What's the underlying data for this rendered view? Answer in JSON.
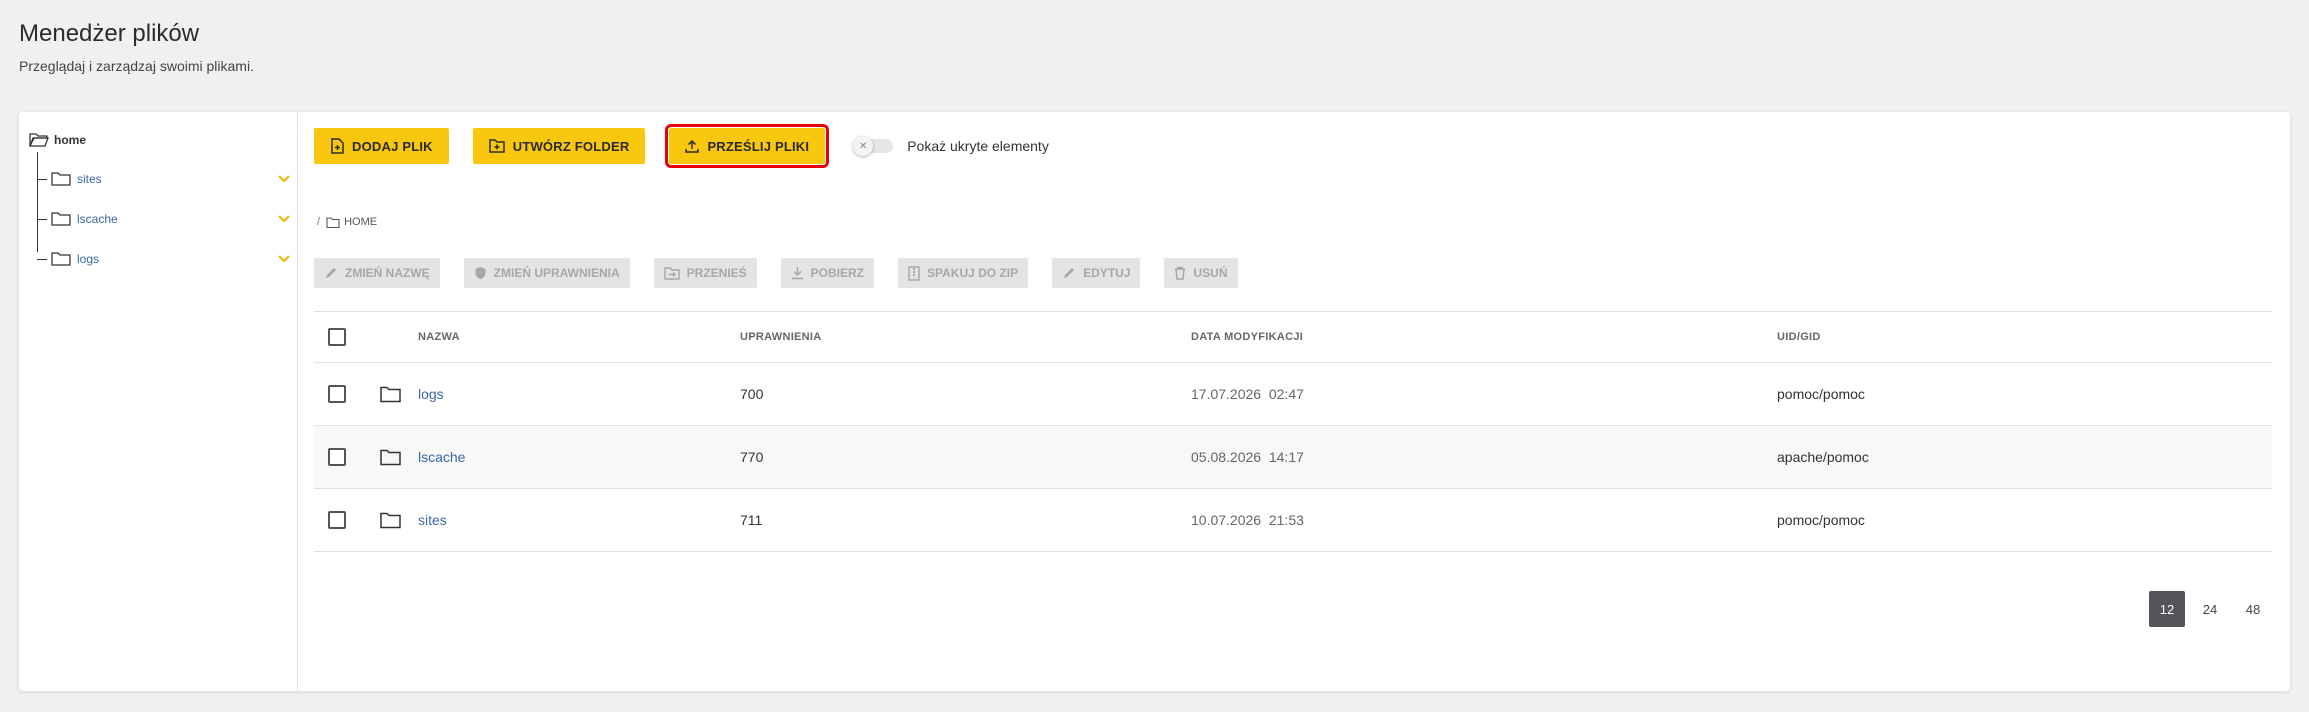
{
  "header": {
    "title": "Menedżer plików",
    "subtitle": "Przeglądaj i zarządzaj swoimi plikami."
  },
  "sidebar": {
    "root": "home",
    "items": [
      {
        "label": "sites"
      },
      {
        "label": "lscache"
      },
      {
        "label": "logs"
      }
    ]
  },
  "toolbar": {
    "add_file": "DODAJ PLIK",
    "create_folder": "UTWÓRZ FOLDER",
    "upload_files": "PRZEŚLIJ PLIKI",
    "toggle_label": "Pokaż ukryte elementy"
  },
  "breadcrumb": {
    "separator": "/",
    "current": "HOME"
  },
  "actions": {
    "rename": "ZMIEŃ NAZWĘ",
    "permissions": "ZMIEŃ UPRAWNIENIA",
    "move": "PRZENIEŚ",
    "download": "POBIERZ",
    "zip": "SPAKUJ DO ZIP",
    "edit": "EDYTUJ",
    "delete": "USUŃ"
  },
  "table": {
    "columns": {
      "name": "NAZWA",
      "permissions": "UPRAWNIENIA",
      "modified": "DATA MODYFIKACJI",
      "uid": "UID/GID"
    },
    "rows": [
      {
        "name": "logs",
        "permissions": "700",
        "date": "17.07.2026",
        "time": "02:47",
        "uid": "pomoc/pomoc"
      },
      {
        "name": "lscache",
        "permissions": "770",
        "date": "05.08.2026",
        "time": "14:17",
        "uid": "apache/pomoc"
      },
      {
        "name": "sites",
        "permissions": "711",
        "date": "10.07.2026",
        "time": "21:53",
        "uid": "pomoc/pomoc"
      }
    ]
  },
  "pagination": {
    "options": [
      "12",
      "24",
      "48"
    ],
    "active": "12"
  },
  "colors": {
    "accent": "#f9c80e",
    "highlight": "#e8000b",
    "link": "#3a68a6"
  }
}
